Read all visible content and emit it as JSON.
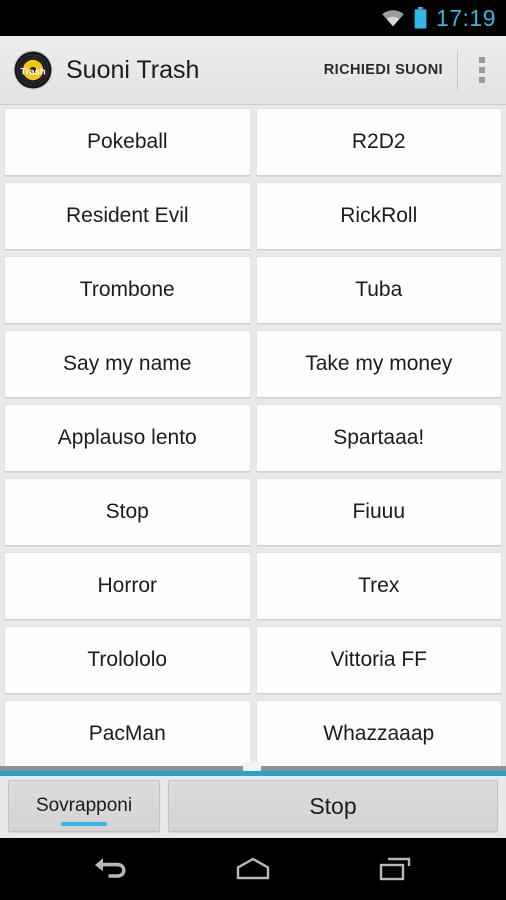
{
  "statusbar": {
    "time": "17:19",
    "icons": [
      "wifi-icon",
      "battery-icon"
    ]
  },
  "actionbar": {
    "logo_icon": "app-logo-vinyl-record-icon",
    "logo_text": "Trash",
    "title": "Suoni Trash",
    "action_label": "RICHIEDI SUONI",
    "overflow_icon": "overflow-menu-icon"
  },
  "sound_grid": {
    "buttons": [
      "Pokeball",
      "R2D2",
      "Resident Evil",
      "RickRoll",
      "Trombone",
      "Tuba",
      "Say my name",
      "Take my money",
      "Applauso lento",
      "Spartaaa!",
      "Stop",
      "Fiuuu",
      "Horror",
      "Trex",
      "Trolololo",
      "Vittoria FF",
      "PacMan",
      "Whazzaaap"
    ]
  },
  "bottombar": {
    "toggle_label": "Sovrapponi",
    "toggle_active": true,
    "stop_label": "Stop"
  },
  "navbar": {
    "keys": [
      "back-icon",
      "home-icon",
      "recents-icon"
    ]
  },
  "colors": {
    "accent": "#33b5e5",
    "scroll_edge": "#26a4cd",
    "statusbar_bg": "#000000",
    "actionbar_bg": "#e9e9e9",
    "button_bg": "#fdfdfd",
    "logo_yellow": "#f4c518"
  }
}
